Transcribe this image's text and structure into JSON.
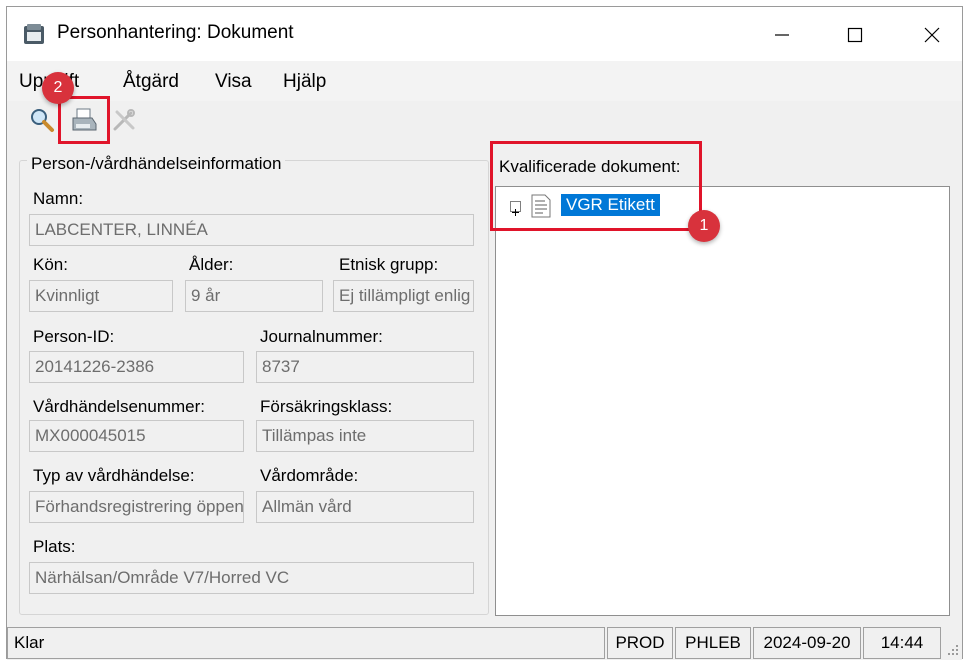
{
  "window": {
    "title": "Personhantering: Dokument",
    "controls": {
      "minimize": "—",
      "maximize": "☐",
      "close": "✕"
    }
  },
  "menubar": {
    "items": [
      {
        "label": "Uppgift"
      },
      {
        "label": "Åtgärd"
      },
      {
        "label": "Visa"
      },
      {
        "label": "Hjälp"
      }
    ]
  },
  "toolbar": {
    "icons": [
      "magnifier-icon",
      "printer-icon",
      "tools-icon"
    ]
  },
  "person_group": {
    "title": "Person-/vårdhändelseinformation",
    "namn_label": "Namn:",
    "namn_value": "LABCENTER, LINNÉA",
    "kon_label": "Kön:",
    "kon_value": "Kvinnligt",
    "alder_label": "Ålder:",
    "alder_value": "9 år",
    "etnisk_label": "Etnisk grupp:",
    "etnisk_value": "Ej tillämpligt enlig",
    "personid_label": "Person-ID:",
    "personid_value": "20141226-2386",
    "journal_label": "Journalnummer:",
    "journal_value": "8737",
    "vardhandelse_label": "Vårdhändelsenummer:",
    "vardhandelse_value": "MX000045015",
    "forsakring_label": "Försäkringsklass:",
    "forsakring_value": "Tillämpas inte",
    "typ_label": "Typ av vårdhändelse:",
    "typ_value": "Förhandsregistrering öppen",
    "vardomrade_label": "Vårdområde:",
    "vardomrade_value": "Allmän vård",
    "plats_label": "Plats:",
    "plats_value": "Närhälsan/Område V7/Horred VC"
  },
  "documents": {
    "label": "Kvalificerade dokument:",
    "tree": [
      {
        "label": "VGR Etikett",
        "expander": "+",
        "selected": true
      }
    ]
  },
  "statusbar": {
    "status": "Klar",
    "env": "PROD",
    "role": "PHLEB",
    "date": "2024-09-20",
    "time": "14:44"
  },
  "annotations": {
    "badge_1": "1",
    "badge_2": "2",
    "color": "#e0142a"
  }
}
